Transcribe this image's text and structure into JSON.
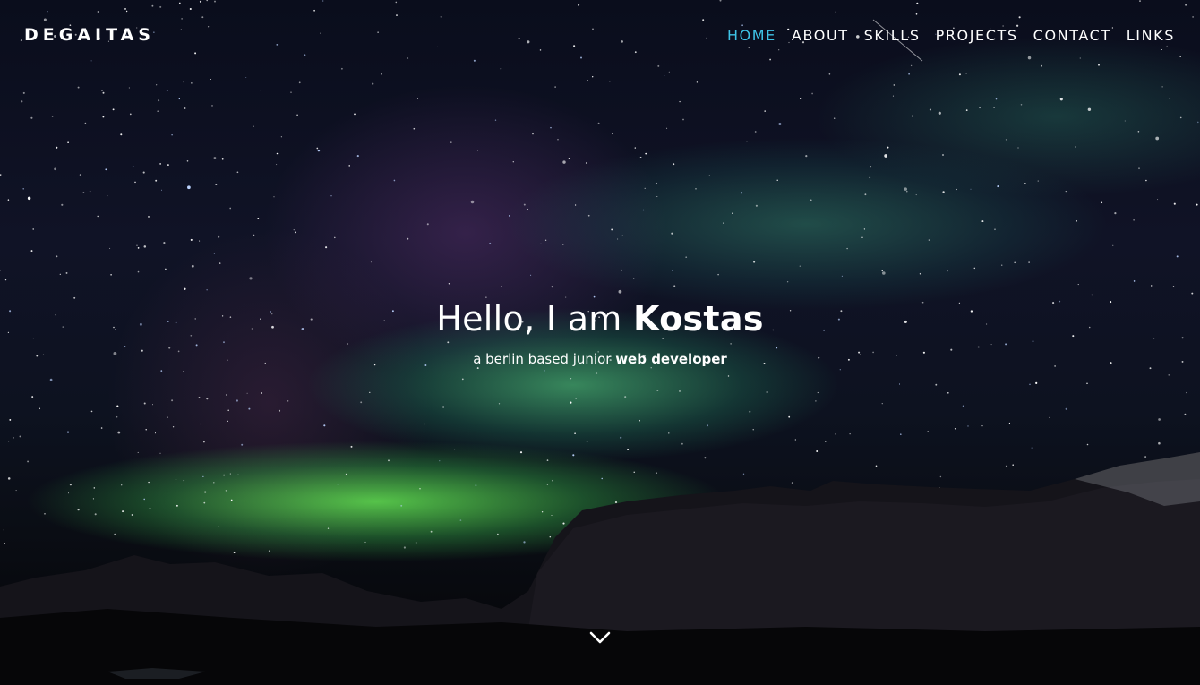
{
  "nav": {
    "brand": "DEGAITAS",
    "items": [
      {
        "label": "HOME",
        "active": true
      },
      {
        "label": "ABOUT",
        "active": false
      },
      {
        "label": "SKILLS",
        "active": false
      },
      {
        "label": "PROJECTS",
        "active": false
      },
      {
        "label": "CONTACT",
        "active": false
      },
      {
        "label": "LINKS",
        "active": false
      }
    ]
  },
  "hero": {
    "greeting": "Hello, I am",
    "name": "Kostas",
    "tagline": "a berlin based junior",
    "role": "web developer",
    "scroll_icon": "chevron-down-icon"
  },
  "colors": {
    "accent": "#3ec3e6",
    "text": "#ffffff"
  }
}
